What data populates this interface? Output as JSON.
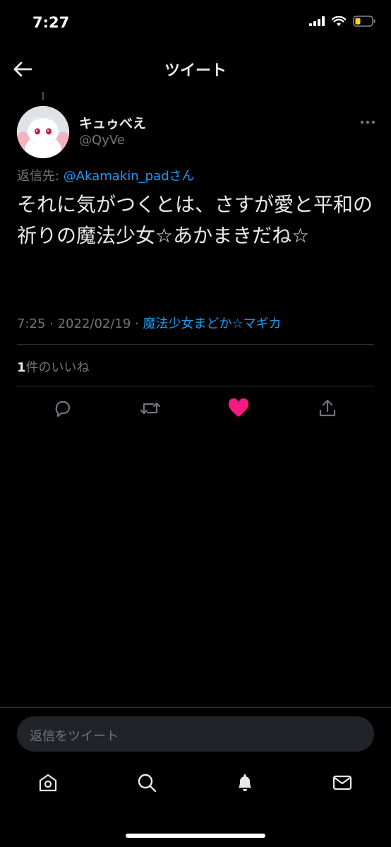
{
  "status": {
    "time": "7:27"
  },
  "nav": {
    "title": "ツイート"
  },
  "tweet": {
    "author_name": "キュゥべえ",
    "author_handle": "@QyVe",
    "reply_prefix": "返信先: ",
    "reply_to": "@Akamakin_padさん",
    "text": "それに気がつくとは、さすが愛と平和の祈りの魔法少女☆あかまきだね☆",
    "time_date": "7:25 · 2022/02/19 · ",
    "source": "魔法少女まどか☆マギカ",
    "like_count": "1",
    "like_label": "件のいいね"
  },
  "reply_box": {
    "placeholder": "返信をツイート"
  },
  "colors": {
    "accent": "#1d9bf0",
    "like": "#f91880",
    "background": "#000000"
  },
  "icons": [
    "back-arrow-icon",
    "more-icon",
    "reply-icon",
    "retweet-icon",
    "like-icon",
    "share-icon",
    "home-icon",
    "search-icon",
    "notifications-icon",
    "messages-icon"
  ]
}
